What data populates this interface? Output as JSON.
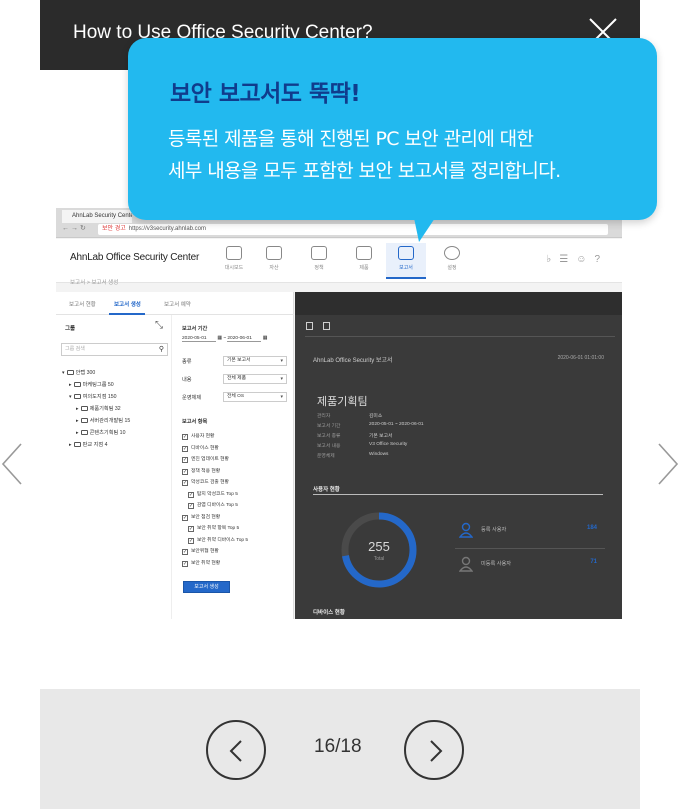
{
  "header": {
    "title": "How to Use Office Security Center?",
    "close_icon": "close-icon"
  },
  "tooltip": {
    "headline": "보안 보고서도 뚝딱!",
    "line1": "등록된 제품을 통해 진행된 PC 보안 관리에 대한",
    "line2": "세부 내용을 모두 포함한 보안 보고서를 정리합니다."
  },
  "screenshot": {
    "browser": {
      "tab_title": "AhnLab Security Center",
      "url_warning": "보안 경고",
      "url": "https://v3security.ahnlab.com"
    },
    "app": {
      "logo": "AhnLab Office Security Center",
      "nav": [
        "대시보드",
        "자산",
        "정책",
        "제품",
        "보고서",
        "설정"
      ],
      "active_nav": "보고서",
      "breadcrumb": "보고서 > 보고서 생성"
    },
    "tabs": [
      "보고서 현황",
      "보고서 생성",
      "보고서 예약"
    ],
    "active_tab": "보고서 생성",
    "group_panel": {
      "title": "그룹",
      "search_placeholder": "그룹 검색",
      "tree": [
        {
          "label": "안랩 300",
          "level": 0
        },
        {
          "label": "마케팅그룹 50",
          "level": 1
        },
        {
          "label": "여의도지점 150",
          "level": 1
        },
        {
          "label": "제품기획팀 32",
          "level": 2
        },
        {
          "label": "서버관리개발팀 15",
          "level": 2
        },
        {
          "label": "콘텐츠기획팀 10",
          "level": 2
        },
        {
          "label": "판교 지점 4",
          "level": 1
        }
      ]
    },
    "form": {
      "period_label": "보고서 기간",
      "date_from": "2020-05-01",
      "date_to": "2020-06-01",
      "type_label": "종류",
      "type_value": "기본 보고서",
      "content_label": "내용",
      "content_value": "전체 제품",
      "os_label": "운영체제",
      "os_value": "전체 OS",
      "items_label": "보고서 항목",
      "items": [
        {
          "label": "사용자 현황",
          "indent": false
        },
        {
          "label": "디바이스 현황",
          "indent": false
        },
        {
          "label": "엔진 업데이트 현황",
          "indent": false
        },
        {
          "label": "정책 적용 현황",
          "indent": false
        },
        {
          "label": "악성코드 검출 현황",
          "indent": false
        },
        {
          "label": "탐지 악성코드 Top 5",
          "indent": true
        },
        {
          "label": "감염 디바이스 Top 5",
          "indent": true
        },
        {
          "label": "보안 점검 현황",
          "indent": false
        },
        {
          "label": "보안 취약 항목 Top 5",
          "indent": true
        },
        {
          "label": "보안 취약 디바이스 Top 5",
          "indent": true
        },
        {
          "label": "보안위협 현황",
          "indent": false
        },
        {
          "label": "보안 취약 현황",
          "indent": false
        }
      ],
      "generate_button": "보고서 생성"
    },
    "report": {
      "brand": "AhnLab Office Security 보고서",
      "date": "2020-06-01 01:01:00",
      "team": "제품기획팀",
      "rows": [
        {
          "k": "관리자",
          "v": "김미소"
        },
        {
          "k": "보고서 기간",
          "v": "2020-05-01 ~ 2020-06-01"
        },
        {
          "k": "보고서 종류",
          "v": "기본 보고서"
        },
        {
          "k": "보고서 내용",
          "v": "V3 Office Security"
        },
        {
          "k": "운영체제",
          "v": "Windows"
        }
      ],
      "user_section": "사용자 현황",
      "total_users": "255",
      "total_unit": "Total",
      "registered_label": "등록 사용자",
      "registered_value": "184",
      "unregistered_label": "미등록 사용자",
      "unregistered_value": "71",
      "device_section": "디바이스 현황"
    }
  },
  "pagination": {
    "current_total": "16/18"
  },
  "colors": {
    "bubble": "#22b9ef",
    "headline": "#103c8c",
    "accent": "#2468c9",
    "header_bg": "#2b2b2b",
    "footer_bg": "#e8e8e8"
  }
}
